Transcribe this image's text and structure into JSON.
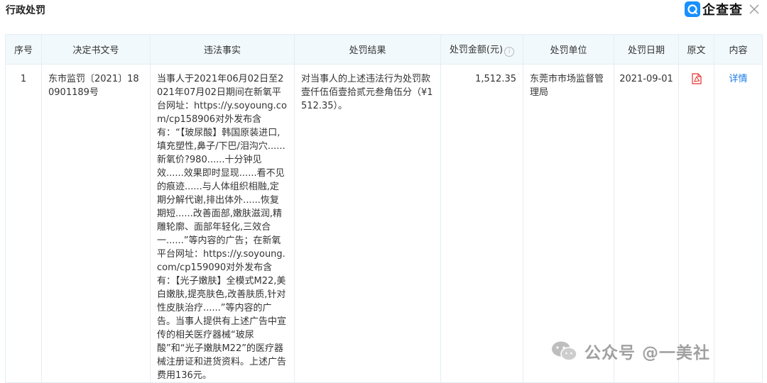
{
  "panel": {
    "title": "行政处罚",
    "brand_name": "企查查",
    "icons": {
      "brand": "brand-logo-icon",
      "close": "close-icon",
      "info": "info-icon",
      "pdf": "pdf-icon",
      "watermark": "wechat-icon"
    }
  },
  "table": {
    "headers": {
      "index": "序号",
      "decision_no": "决定书文号",
      "facts": "违法事实",
      "result": "处罚结果",
      "amount": "处罚金额(元)",
      "unit": "处罚单位",
      "date": "处罚日期",
      "original": "原文",
      "content": "内容"
    },
    "rows": [
      {
        "index": "1",
        "decision_no": "东市监罚〔2021〕180901189号",
        "facts": "当事人于2021年06月02日至2021年07月02日期间在新氧平台网址：https://y.soyoung.com/cp158906对外发布含有：“【玻尿酸】韩国原装进口,填充塑性,鼻子/下巴/泪沟穴......新氧价?980......十分钟见效......效果即时显现......看不见的痕迹......与人体组织相融,定期分解代谢,排出体外......恢复期短......改善面部,嫩肤滋润,精雕轮廓、面部年轻化,三效合一......”等内容的广告；在新氧平台网址：https://y.soyoung.com/cp159090对外发布含有：【光子嫩肤】全模式M22,美白嫩肤,提亮肤色,改善肤质,针对性皮肤治疗......”等内容的广告。当事人提供有上述广告中宣传的相关医疗器械“玻尿酸”和“光子嫩肤M22”的医疗器械注册证和进货资料。上述广告费用136元。",
        "result": "对当事人的上述违法行为处罚款壹仟伍佰壹拾贰元叁角伍分（¥1512.35）。",
        "amount": "1,512.35",
        "unit": "东莞市市场监督管理局",
        "date": "2021-09-01",
        "content_link": "详情"
      }
    ]
  },
  "watermark": {
    "text": "公众号 @一美社"
  },
  "colors": {
    "header_bg": "#f2f9fc",
    "border": "#e4eef3",
    "link": "#1a7be8",
    "pdf_red": "#e5322d",
    "brand_blue": "#1890ff"
  }
}
